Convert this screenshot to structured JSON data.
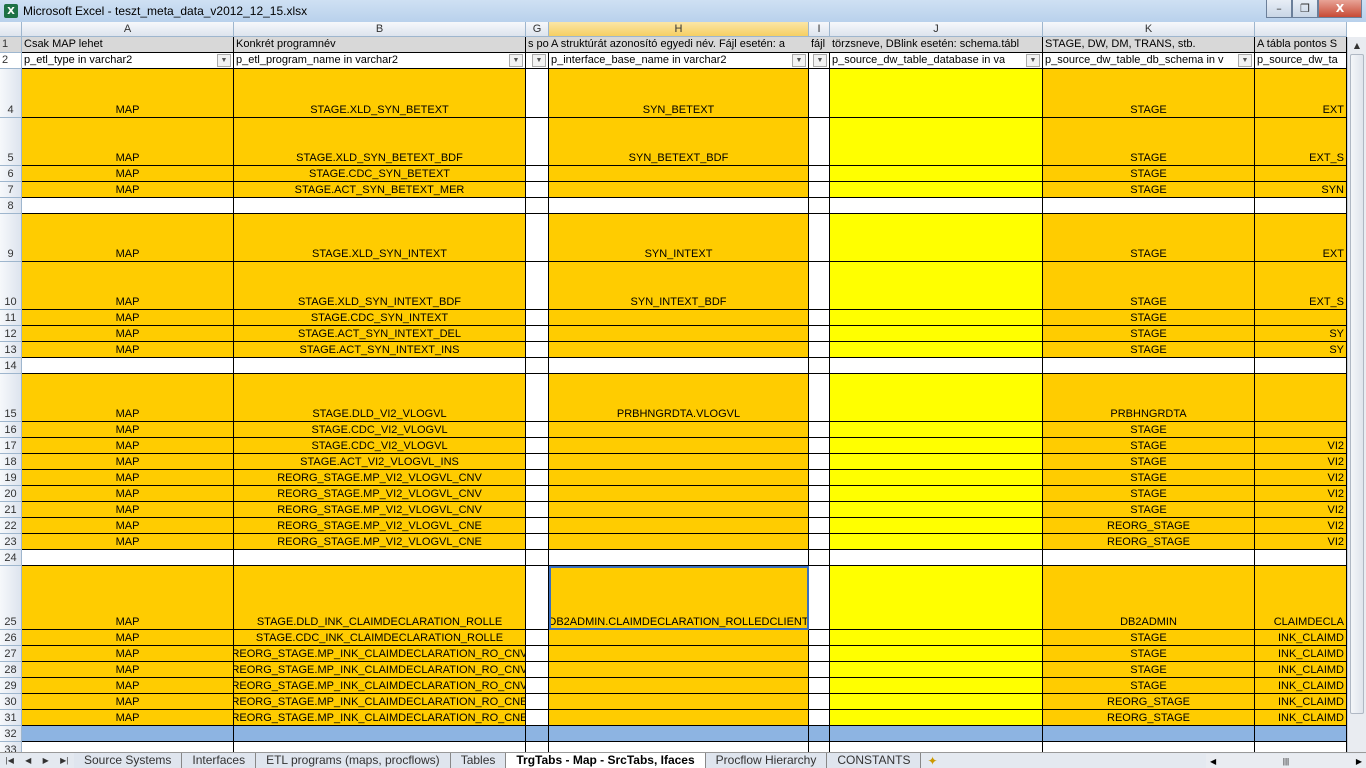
{
  "window": {
    "title": "Microsoft Excel - teszt_meta_data_v2012_12_15.xlsx",
    "minimize": "–",
    "restore": "❐",
    "close": "X"
  },
  "columns": [
    {
      "key": "A",
      "label": "A",
      "w": 212,
      "r1": "Csak MAP lehet",
      "r2": "p_etl_type in varchar2"
    },
    {
      "key": "B",
      "label": "B",
      "w": 292,
      "r1": "Konkrét programnév",
      "r2": "p_etl_program_name in varchar2"
    },
    {
      "key": "G",
      "label": "G",
      "w": 23,
      "r1": "s po",
      "r2": ""
    },
    {
      "key": "H",
      "label": "H",
      "w": 260,
      "r1": "A struktúrát azonosító egyedi név. Fájl esetén: a",
      "r2": "p_interface_base_name in varchar2",
      "selected": true
    },
    {
      "key": "I",
      "label": "I",
      "w": 21,
      "r1": "fájl",
      "r2": ""
    },
    {
      "key": "J",
      "label": "J",
      "w": 213,
      "r1": "törzsneve, DBlink esetén: schema.tábl",
      "r2": "p_source_dw_table_database in va"
    },
    {
      "key": "K",
      "label": "K",
      "w": 212,
      "r1": "STAGE, DW, DM, TRANS, stb.",
      "r2": "p_source_dw_table_db_schema in v"
    },
    {
      "key": "L",
      "label": "",
      "w": 92,
      "r1": "A tábla pontos S",
      "r2": "p_source_dw_ta"
    }
  ],
  "rows": [
    {
      "n": "4",
      "h": 49,
      "A": "MAP",
      "B": "STAGE.XLD_SYN_BETEXT",
      "H": "SYN_BETEXT",
      "K": "STAGE",
      "L": "EXT"
    },
    {
      "n": "5",
      "h": 48,
      "A": "MAP",
      "B": "STAGE.XLD_SYN_BETEXT_BDF",
      "H": "SYN_BETEXT_BDF",
      "K": "STAGE",
      "L": "EXT_S"
    },
    {
      "n": "6",
      "h": 16,
      "A": "MAP",
      "B": "STAGE.CDC_SYN_BETEXT",
      "H": "",
      "K": "STAGE",
      "L": ""
    },
    {
      "n": "7",
      "h": 16,
      "A": "MAP",
      "B": "STAGE.ACT_SYN_BETEXT_MER",
      "H": "",
      "K": "STAGE",
      "L": "SYN"
    },
    {
      "n": "8",
      "h": 16,
      "blank": true
    },
    {
      "n": "9",
      "h": 48,
      "A": "MAP",
      "B": "STAGE.XLD_SYN_INTEXT",
      "H": "SYN_INTEXT",
      "K": "STAGE",
      "L": "EXT"
    },
    {
      "n": "10",
      "h": 48,
      "A": "MAP",
      "B": "STAGE.XLD_SYN_INTEXT_BDF",
      "H": "SYN_INTEXT_BDF",
      "K": "STAGE",
      "L": "EXT_S"
    },
    {
      "n": "11",
      "h": 16,
      "A": "MAP",
      "B": "STAGE.CDC_SYN_INTEXT",
      "H": "",
      "K": "STAGE",
      "L": ""
    },
    {
      "n": "12",
      "h": 16,
      "A": "MAP",
      "B": "STAGE.ACT_SYN_INTEXT_DEL",
      "H": "",
      "K": "STAGE",
      "L": "SY"
    },
    {
      "n": "13",
      "h": 16,
      "A": "MAP",
      "B": "STAGE.ACT_SYN_INTEXT_INS",
      "H": "",
      "K": "STAGE",
      "L": "SY"
    },
    {
      "n": "14",
      "h": 16,
      "blank": true
    },
    {
      "n": "15",
      "h": 48,
      "A": "MAP",
      "B": "STAGE.DLD_VI2_VLOGVL",
      "H": "PRBHNGRDTA.VLOGVL",
      "K": "PRBHNGRDTA",
      "L": ""
    },
    {
      "n": "16",
      "h": 16,
      "A": "MAP",
      "B": "STAGE.CDC_VI2_VLOGVL",
      "H": "",
      "K": "STAGE",
      "L": ""
    },
    {
      "n": "17",
      "h": 16,
      "A": "MAP",
      "B": "STAGE.CDC_VI2_VLOGVL",
      "H": "",
      "K": "STAGE",
      "L": "VI2"
    },
    {
      "n": "18",
      "h": 16,
      "A": "MAP",
      "B": "STAGE.ACT_VI2_VLOGVL_INS",
      "H": "",
      "K": "STAGE",
      "L": "VI2"
    },
    {
      "n": "19",
      "h": 16,
      "A": "MAP",
      "B": "REORG_STAGE.MP_VI2_VLOGVL_CNV",
      "H": "",
      "K": "STAGE",
      "L": "VI2"
    },
    {
      "n": "20",
      "h": 16,
      "A": "MAP",
      "B": "REORG_STAGE.MP_VI2_VLOGVL_CNV",
      "H": "",
      "K": "STAGE",
      "L": "VI2"
    },
    {
      "n": "21",
      "h": 16,
      "A": "MAP",
      "B": "REORG_STAGE.MP_VI2_VLOGVL_CNV",
      "H": "",
      "K": "STAGE",
      "L": "VI2"
    },
    {
      "n": "22",
      "h": 16,
      "A": "MAP",
      "B": "REORG_STAGE.MP_VI2_VLOGVL_CNE",
      "H": "",
      "K": "REORG_STAGE",
      "L": "VI2"
    },
    {
      "n": "23",
      "h": 16,
      "A": "MAP",
      "B": "REORG_STAGE.MP_VI2_VLOGVL_CNE",
      "H": "",
      "K": "REORG_STAGE",
      "L": "VI2"
    },
    {
      "n": "24",
      "h": 16,
      "blank": true
    },
    {
      "n": "25",
      "h": 64,
      "A": "MAP",
      "B": "STAGE.DLD_INK_CLAIMDECLARATION_ROLLE",
      "H": "DB2ADMIN.CLAIMDECLARATION_ROLLEDCLIENT",
      "K": "DB2ADMIN",
      "L": "CLAIMDECLA",
      "selH": true
    },
    {
      "n": "26",
      "h": 16,
      "A": "MAP",
      "B": "STAGE.CDC_INK_CLAIMDECLARATION_ROLLE",
      "H": "",
      "K": "STAGE",
      "L": "INK_CLAIMD"
    },
    {
      "n": "27",
      "h": 16,
      "A": "MAP",
      "B": "REORG_STAGE.MP_INK_CLAIMDECLARATION_RO_CNV",
      "H": "",
      "K": "STAGE",
      "L": "INK_CLAIMD"
    },
    {
      "n": "28",
      "h": 16,
      "A": "MAP",
      "B": "REORG_STAGE.MP_INK_CLAIMDECLARATION_RO_CNV",
      "H": "",
      "K": "STAGE",
      "L": "INK_CLAIMD"
    },
    {
      "n": "29",
      "h": 16,
      "A": "MAP",
      "B": "REORG_STAGE.MP_INK_CLAIMDECLARATION_RO_CNV",
      "H": "",
      "K": "STAGE",
      "L": "INK_CLAIMD"
    },
    {
      "n": "30",
      "h": 16,
      "A": "MAP",
      "B": "REORG_STAGE.MP_INK_CLAIMDECLARATION_RO_CNE",
      "H": "",
      "K": "REORG_STAGE",
      "L": "INK_CLAIMD"
    },
    {
      "n": "31",
      "h": 16,
      "A": "MAP",
      "B": "REORG_STAGE.MP_INK_CLAIMDECLARATION_RO_CNE",
      "H": "",
      "K": "REORG_STAGE",
      "L": "INK_CLAIMD"
    },
    {
      "n": "32",
      "h": 16,
      "blue": true
    },
    {
      "n": "33",
      "h": 16,
      "blank": true
    }
  ],
  "colors": {
    "orange": "#FFCC00",
    "yellow": "#FFFF00",
    "blue": "#8DB4E2"
  },
  "sheet_tabs": [
    "Source Systems",
    "Interfaces",
    "ETL programs (maps, procflows)",
    "Tables",
    "TrgTabs - Map - SrcTabs, Ifaces",
    "Procflow Hierarchy",
    "CONSTANTS"
  ],
  "active_tab": "TrgTabs - Map - SrcTabs, Ifaces"
}
